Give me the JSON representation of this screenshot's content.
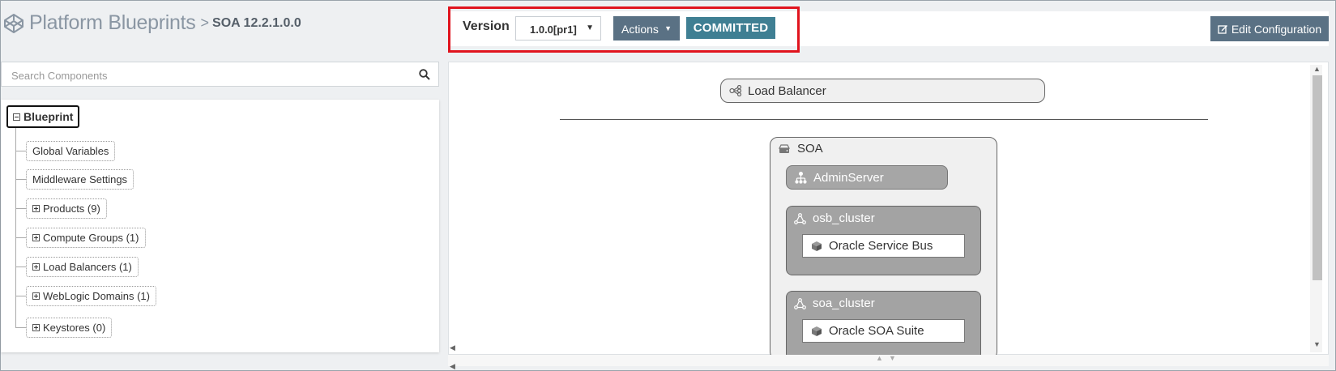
{
  "header": {
    "app_title": "Platform Blueprints",
    "separator": ">",
    "subtitle": "SOA 12.2.1.0.0"
  },
  "toolbar": {
    "version_label": "Version",
    "version_value": "1.0.0[pr1]",
    "actions_label": "Actions",
    "status_badge": "COMMITTED",
    "edit_label": "Edit Configuration"
  },
  "search": {
    "placeholder": "Search Components"
  },
  "tree": {
    "root": "Blueprint",
    "items": [
      {
        "label": "Global Variables",
        "expandable": false
      },
      {
        "label": "Middleware Settings",
        "expandable": false
      },
      {
        "label": "Products (9)",
        "expandable": true
      },
      {
        "label": "Compute Groups (1)",
        "expandable": true
      },
      {
        "label": "Load Balancers (1)",
        "expandable": true
      },
      {
        "label": "WebLogic Domains (1)",
        "expandable": true
      },
      {
        "label": "Keystores (0)",
        "expandable": true
      }
    ]
  },
  "diagram": {
    "load_balancer": "Load Balancer",
    "domain": "SOA",
    "admin_server": "AdminServer",
    "clusters": [
      {
        "name": "osb_cluster",
        "product": "Oracle Service Bus"
      },
      {
        "name": "soa_cluster",
        "product": "Oracle SOA Suite"
      }
    ]
  },
  "icons": {
    "brand": "codepen-cube-icon",
    "search": "search-icon",
    "edit": "edit-icon",
    "load_balancer": "share-nodes-icon",
    "domain": "drive-icon",
    "admin": "sitemap-icon",
    "cluster": "cluster-icon",
    "product": "cube-icon"
  },
  "colors": {
    "accent_button": "#5a7184",
    "committed": "#3f7f93",
    "highlight_border": "#e0141e",
    "node_gray": "#a6a6a6"
  }
}
